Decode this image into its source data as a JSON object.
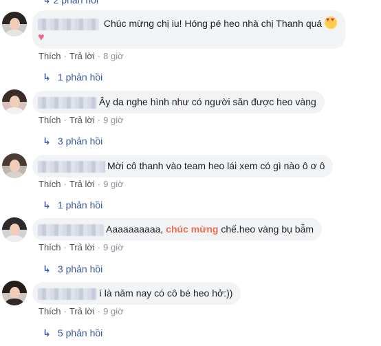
{
  "top_replies": "2 phản hồi",
  "comments": [
    {
      "text": "Chúc mừng chị iu! Hóng pé heo nhà chị Thanh quá",
      "like": "Thích",
      "reply": "Trả lời",
      "time": "8 giờ",
      "replies": "1 phản hồi"
    },
    {
      "text": "Ây da nghe hình như có người săn được heo vàng",
      "like": "Thích",
      "reply": "Trả lời",
      "time": "9 giờ",
      "replies": "3 phản hồi"
    },
    {
      "text": "Mời cô thanh vào team heo lái xem có gì nào ô ơ ô",
      "like": "Thích",
      "reply": "Trả lời",
      "time": "9 giờ",
      "replies": "1 phản hồi"
    },
    {
      "text_before": "Aaaaaaaaaa, ",
      "text_highlight": "chúc mừng",
      "text_after": " chế.heo vàng bụ bẫm",
      "like": "Thích",
      "reply": "Trả lời",
      "time": "9 giờ",
      "replies": "3 phản hồi"
    },
    {
      "text": "í là năm nay có cô bé heo hở:))",
      "like": "Thích",
      "reply": "Trả lời",
      "time": "9 giờ",
      "replies": "5 phản hồi"
    }
  ],
  "colors": {
    "link": "#365899",
    "highlight": "#f06b4e",
    "bubble": "#f2f3f5",
    "meta": "#90949c"
  },
  "icons": {
    "reply_arrow": "reply-arrow-icon",
    "heart": "heart-icon",
    "emoji": "heart-eyes-emoji-icon"
  }
}
